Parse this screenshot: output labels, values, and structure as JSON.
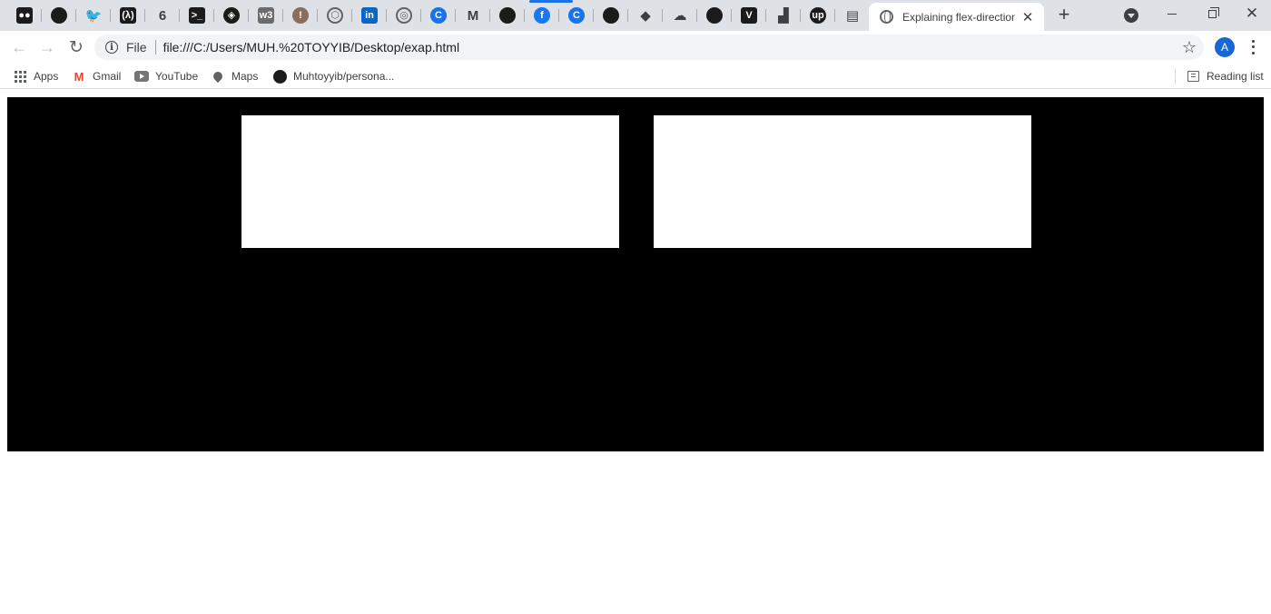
{
  "browser": {
    "pinned_tabs": [
      {
        "name": "medium-favicon-icon",
        "glyph": "●●",
        "style": "sq dark"
      },
      {
        "name": "github-favicon-icon",
        "glyph": "",
        "style": "ci dark"
      },
      {
        "name": "twitter-favicon-icon",
        "glyph": "🐦",
        "style": "plain"
      },
      {
        "name": "freecodecamp-favicon-icon",
        "glyph": "(λ)",
        "style": "sq dark"
      },
      {
        "name": "sixth-favicon-icon",
        "glyph": "6",
        "style": "plain"
      },
      {
        "name": "terminal-favicon-icon",
        "glyph": ">_",
        "style": "sq dark"
      },
      {
        "name": "codepen-favicon-icon",
        "glyph": "◈",
        "style": "ci dark"
      },
      {
        "name": "w3schools-favicon-icon",
        "glyph": "w3",
        "style": "sq grey"
      },
      {
        "name": "alert-favicon-icon",
        "glyph": "!",
        "style": "ci brown"
      },
      {
        "name": "hexagon-favicon-icon",
        "glyph": "⬡",
        "style": "ci outline"
      },
      {
        "name": "linkedin-favicon-icon",
        "glyph": "in",
        "style": "sq lnk"
      },
      {
        "name": "shield-favicon-icon",
        "glyph": "◎",
        "style": "ci outline"
      },
      {
        "name": "grammarly-favicon-icon",
        "glyph": "C",
        "style": "ci blue"
      },
      {
        "name": "gmail-favicon-icon",
        "glyph": "M",
        "style": "plain"
      },
      {
        "name": "github-favicon-icon",
        "glyph": "",
        "style": "ci dark"
      },
      {
        "name": "facebook-favicon-icon",
        "glyph": "f",
        "style": "ci fb"
      },
      {
        "name": "grammarly-favicon-icon",
        "glyph": "C",
        "style": "ci blue"
      },
      {
        "name": "github-favicon-icon",
        "glyph": "",
        "style": "ci dark"
      },
      {
        "name": "git-favicon-icon",
        "glyph": "◆",
        "style": "plain"
      },
      {
        "name": "cloud-favicon-icon",
        "glyph": "☁",
        "style": "plain"
      },
      {
        "name": "github-favicon-icon",
        "glyph": "",
        "style": "ci dark"
      },
      {
        "name": "vuetify-favicon-icon",
        "glyph": "V",
        "style": "sq dark"
      },
      {
        "name": "chart-favicon-icon",
        "glyph": "▟",
        "style": "plain"
      },
      {
        "name": "upwork-favicon-icon",
        "glyph": "up",
        "style": "ci dark"
      },
      {
        "name": "store-favicon-icon",
        "glyph": "▤",
        "style": "plain"
      }
    ],
    "active_tab": {
      "title": "Explaining flex-direction",
      "close": "✕"
    },
    "new_tab": "+",
    "window": {
      "minimize": "",
      "close": "✕"
    },
    "toolbar": {
      "back": "←",
      "forward": "→",
      "reload": "↻",
      "scheme": "File",
      "url": "file:///C:/Users/MUH.%20TOYYIB/Desktop/exap.html",
      "star": "☆",
      "profile_initial": "A"
    },
    "bookmarks": {
      "apps": "Apps",
      "gmail": "Gmail",
      "youtube": "YouTube",
      "maps": "Maps",
      "github": "Muhtoyyib/persona...",
      "reading_list": "Reading list"
    }
  },
  "page": {
    "container_color": "#000000",
    "box_color": "#ffffff",
    "boxes": [
      "",
      ""
    ]
  }
}
